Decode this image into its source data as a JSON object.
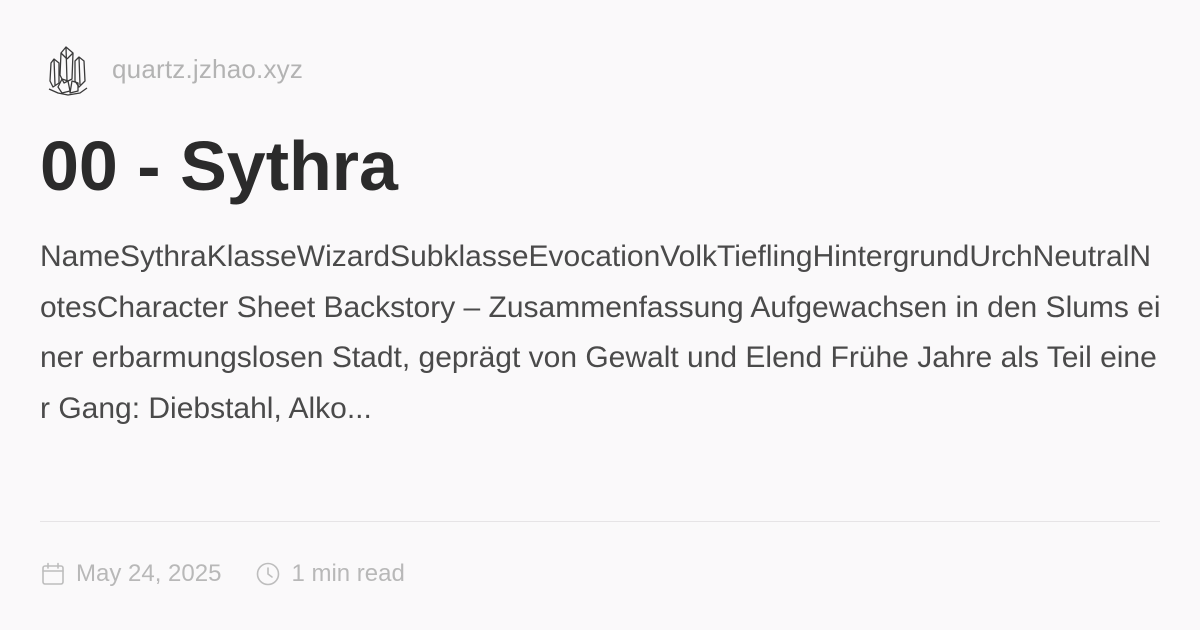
{
  "site": {
    "logo_icon": "crystal-icon",
    "domain": "quartz.jzhao.xyz"
  },
  "page": {
    "title": "00 - Sythra",
    "description": "NameSythraKlasseWizardSubklasseEvocationVolkTieflingHintergrundUrchNeutralNotesCharacter Sheet Backstory – Zusammenfassung Aufgewachsen in den Slums einer erbarmungslosen Stadt, geprägt von Gewalt und Elend Frühe Jahre als Teil einer Gang: Diebstahl, Alko..."
  },
  "meta": {
    "date_icon": "calendar-icon",
    "date": "May 24, 2025",
    "read_icon": "clock-icon",
    "read_time": "1 min read"
  },
  "colors": {
    "background": "#faf9fa",
    "title": "#2b2b2b",
    "body_text": "#4a4a4a",
    "muted": "#b3b3b3",
    "divider": "#e6e4e6"
  }
}
